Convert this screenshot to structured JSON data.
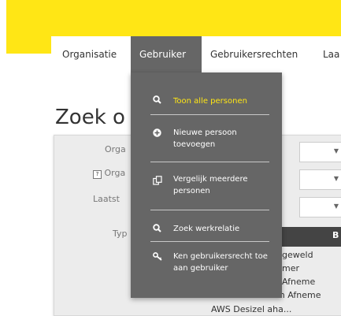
{
  "nav": {
    "items": [
      {
        "label": "Organisatie"
      },
      {
        "label": "Gebruiker"
      },
      {
        "label": "Gebruikersrechten"
      },
      {
        "label": "Laa"
      }
    ]
  },
  "page": {
    "title": "Zoek o"
  },
  "form": {
    "labels": {
      "org": "Orga",
      "org2": "Orga",
      "laatst": "Laatst",
      "type": "Typ"
    },
    "help_glyph": "?"
  },
  "table": {
    "header_partial": "B",
    "rows": [
      "geweld",
      "mer",
      "Afneme",
      "APEX Workbench Afneme",
      "AWS Desizel aha..."
    ]
  },
  "dropdown": {
    "items": [
      {
        "label": "Toon alle personen",
        "icon": "search-icon"
      },
      {
        "label": "Nieuwe persoon toevoegen",
        "icon": "plus-circle-icon"
      },
      {
        "label": "Vergelijk meerdere personen",
        "icon": "compare-icon"
      },
      {
        "label": "Zoek werkrelatie",
        "icon": "search-icon"
      },
      {
        "label": "Ken gebruikersrecht toe aan gebruiker",
        "icon": "key-icon"
      }
    ]
  },
  "colors": {
    "accent": "#ffe615",
    "menu_bg": "#666666"
  }
}
